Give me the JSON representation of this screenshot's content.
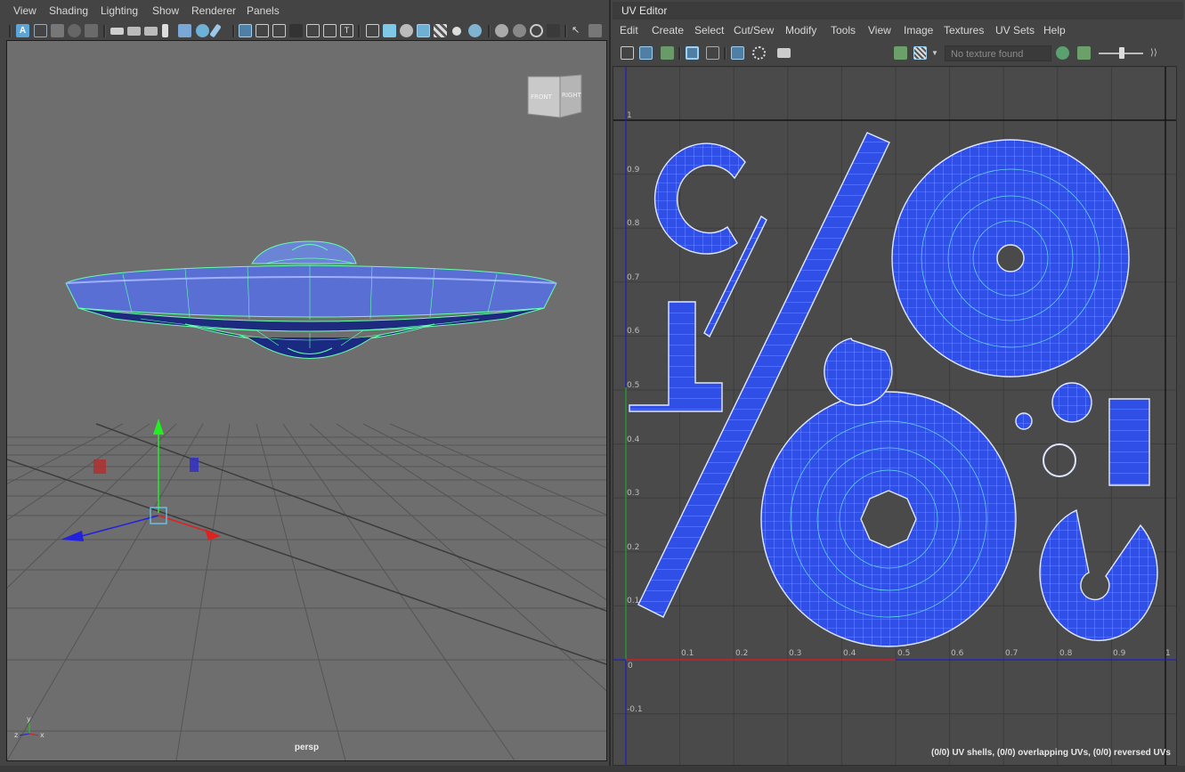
{
  "viewport": {
    "menu": [
      "View",
      "Shading",
      "Lighting",
      "Show",
      "Renderer",
      "Panels"
    ],
    "camera_label": "persp",
    "viewcube": {
      "front": "FRONT",
      "right": "RIGHT"
    },
    "axis_labels": {
      "y": "y",
      "x": "x",
      "z": "z"
    },
    "icons": [
      "select-camera-icon",
      "camera-attributes-icon",
      "bookmark-icon",
      "image-plane-icon",
      "grid-icon",
      "film-gate-icon",
      "resolution-gate-icon",
      "gate-mask-icon",
      "wireframe-icon",
      "smooth-shade-icon",
      "wireframe-on-shaded-icon",
      "textured-icon",
      "lights-icon",
      "shadows-icon",
      "ambient-occlusion-icon",
      "isolate-select-icon",
      "xray-icon"
    ]
  },
  "uv_editor": {
    "title": "UV Editor",
    "menu": [
      "Edit",
      "Create",
      "Select",
      "Cut/Sew",
      "Modify",
      "Tools",
      "View",
      "Image",
      "Textures",
      "UV Sets",
      "Help"
    ],
    "texture_field": "No texture found",
    "x_ticks": [
      "0",
      "0.1",
      "0.2",
      "0.3",
      "0.4",
      "0.5",
      "0.6",
      "0.7",
      "0.8",
      "0.9",
      "1"
    ],
    "y_ticks": [
      "1",
      "0.9",
      "0.8",
      "0.7",
      "0.6",
      "0.5",
      "0.4",
      "0.3",
      "0.2",
      "0.1",
      "-0.1"
    ],
    "status": "(0/0) UV shells, (0/0) overlapping UVs, (0/0) reversed UVs",
    "colors": {
      "shell_fill": "#2f4fe6",
      "shell_wire": "#62e0f0",
      "u_axis": "#d02020",
      "v_axis": "#2020c0"
    }
  }
}
